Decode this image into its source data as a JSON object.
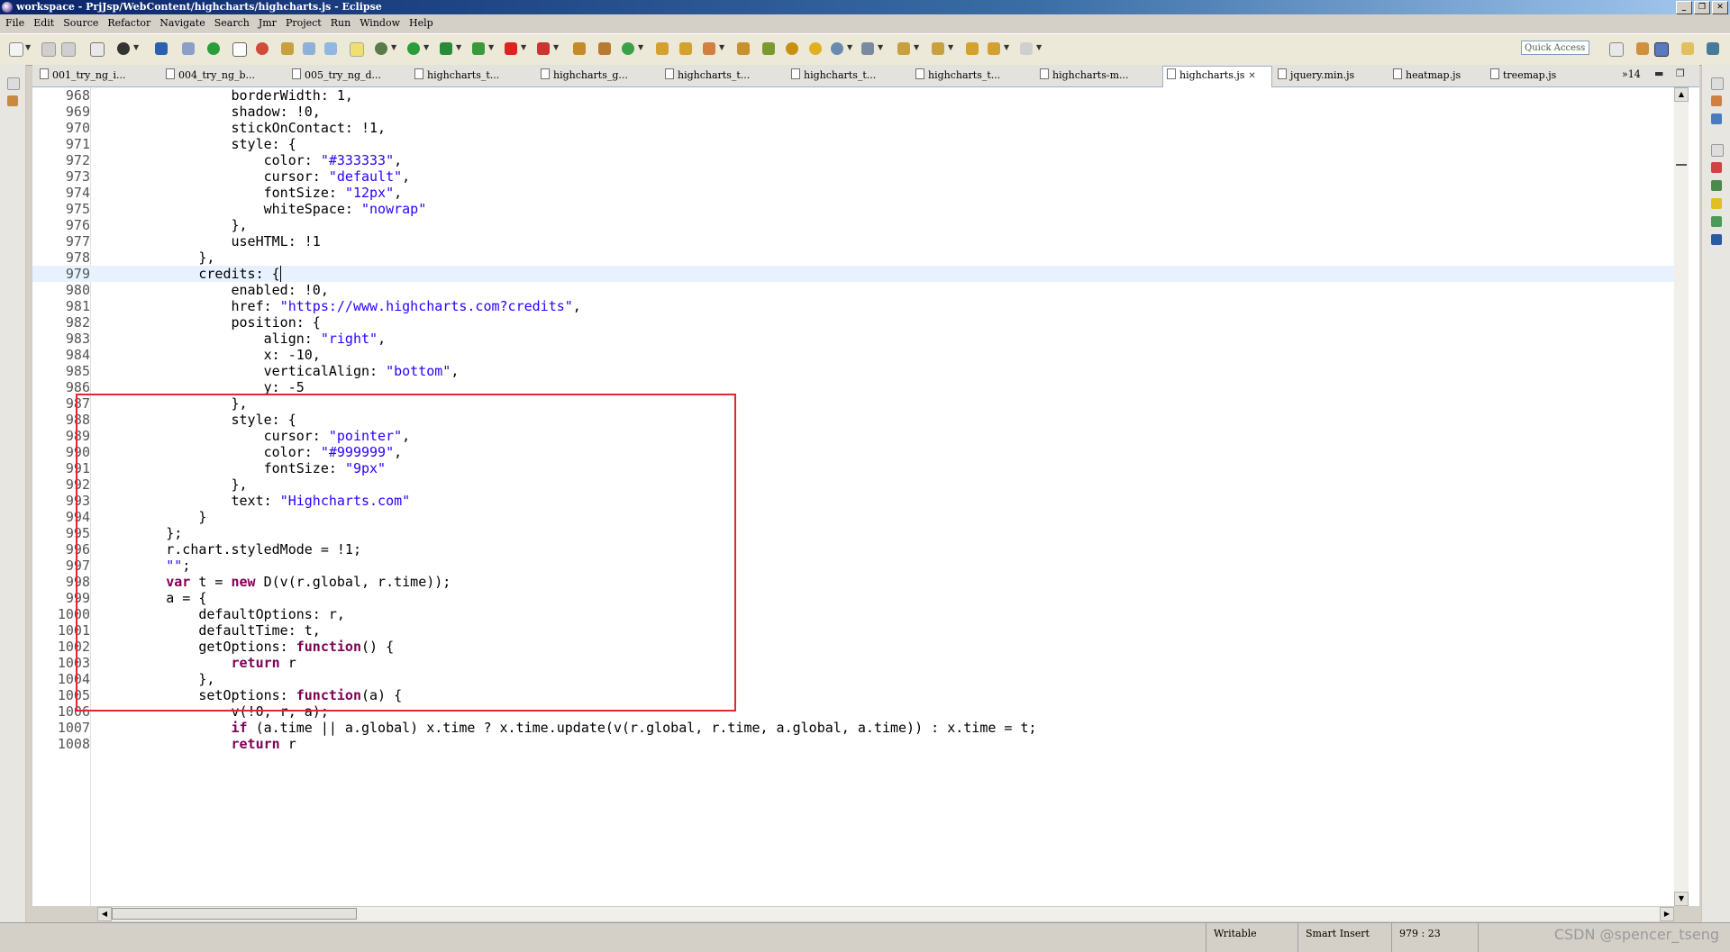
{
  "window": {
    "title": "workspace - PrjJsp/WebContent/highcharts/highcharts.js - Eclipse",
    "minimize_glyph": "_",
    "restore_glyph": "❐",
    "close_glyph": "✕"
  },
  "menu": [
    "File",
    "Edit",
    "Source",
    "Refactor",
    "Navigate",
    "Search",
    "Jmr",
    "Project",
    "Run",
    "Window",
    "Help"
  ],
  "toolbar": {
    "quick_access_placeholder": "Quick Access"
  },
  "tabs": [
    {
      "label": "001_try_ng_i...",
      "active": false
    },
    {
      "label": "004_try_ng_b...",
      "active": false
    },
    {
      "label": "005_try_ng_d...",
      "active": false
    },
    {
      "label": "highcharts_t...",
      "active": false
    },
    {
      "label": "highcharts_g...",
      "active": false
    },
    {
      "label": "highcharts_t...",
      "active": false
    },
    {
      "label": "highcharts_t...",
      "active": false
    },
    {
      "label": "highcharts_t...",
      "active": false
    },
    {
      "label": "highcharts-m...",
      "active": false
    },
    {
      "label": "highcharts.js",
      "active": true
    },
    {
      "label": "jquery.min.js",
      "active": false
    },
    {
      "label": "heatmap.js",
      "active": false
    },
    {
      "label": "treemap.js",
      "active": false
    }
  ],
  "tab_overflow": "»14",
  "editor": {
    "current_line": 979,
    "lines": [
      {
        "n": "968",
        "t": "                borderWidth: 1,"
      },
      {
        "n": "969",
        "t": "                shadow: !0,"
      },
      {
        "n": "970",
        "t": "                stickOnContact: !1,"
      },
      {
        "n": "971",
        "t": "                style: {"
      },
      {
        "n": "972",
        "t": "                    color: \"#333333\","
      },
      {
        "n": "973",
        "t": "                    cursor: \"default\","
      },
      {
        "n": "974",
        "t": "                    fontSize: \"12px\","
      },
      {
        "n": "975",
        "t": "                    whiteSpace: \"nowrap\""
      },
      {
        "n": "976",
        "t": "                },"
      },
      {
        "n": "977",
        "t": "                useHTML: !1"
      },
      {
        "n": "978",
        "t": "            },"
      },
      {
        "n": "979",
        "t": "            credits: {"
      },
      {
        "n": "980",
        "t": "                enabled: !0,"
      },
      {
        "n": "981",
        "t": "                href: \"https://www.highcharts.com?credits\","
      },
      {
        "n": "982",
        "t": "                position: {"
      },
      {
        "n": "983",
        "t": "                    align: \"right\","
      },
      {
        "n": "984",
        "t": "                    x: -10,"
      },
      {
        "n": "985",
        "t": "                    verticalAlign: \"bottom\","
      },
      {
        "n": "986",
        "t": "                    y: -5"
      },
      {
        "n": "987",
        "t": "                },"
      },
      {
        "n": "988",
        "t": "                style: {"
      },
      {
        "n": "989",
        "t": "                    cursor: \"pointer\","
      },
      {
        "n": "990",
        "t": "                    color: \"#999999\","
      },
      {
        "n": "991",
        "t": "                    fontSize: \"9px\""
      },
      {
        "n": "992",
        "t": "                },"
      },
      {
        "n": "993",
        "t": "                text: \"Highcharts.com\""
      },
      {
        "n": "994",
        "t": "            }"
      },
      {
        "n": "995",
        "t": "        };"
      },
      {
        "n": "996",
        "t": "        r.chart.styledMode = !1;"
      },
      {
        "n": "997",
        "t": "        \"\";"
      },
      {
        "n": "998",
        "t": "        var t = new D(v(r.global, r.time));"
      },
      {
        "n": "999",
        "t": "        a = {"
      },
      {
        "n": "1000",
        "t": "            defaultOptions: r,"
      },
      {
        "n": "1001",
        "t": "            defaultTime: t,"
      },
      {
        "n": "1002",
        "t": "            getOptions: function() {"
      },
      {
        "n": "1003",
        "t": "                return r"
      },
      {
        "n": "1004",
        "t": "            },"
      },
      {
        "n": "1005",
        "t": "            setOptions: function(a) {"
      },
      {
        "n": "1006",
        "t": "                v(!0, r, a);"
      },
      {
        "n": "1007",
        "t": "                if (a.time || a.global) x.time ? x.time.update(v(r.global, r.time, a.global, a.time)) : x.time = t;"
      },
      {
        "n": "1008",
        "t": "                return r"
      }
    ]
  },
  "status": {
    "mode": "Writable",
    "insert": "Smart Insert",
    "position": "979 : 23"
  },
  "watermark": "CSDN @spencer_tseng",
  "colors": {
    "keyword": "#7f0055",
    "string": "#2a00ff",
    "highlight_border": "#e0282e",
    "current_line": "#e8f2fe"
  }
}
